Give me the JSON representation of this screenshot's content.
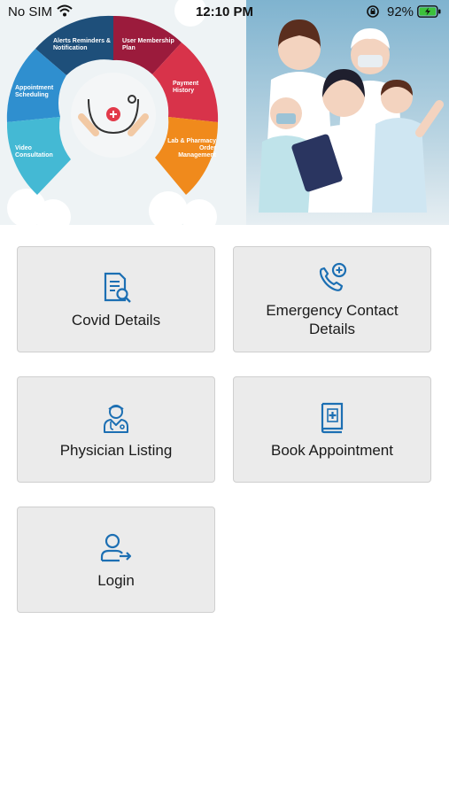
{
  "status_bar": {
    "carrier": "No SIM",
    "time": "12:10 PM",
    "battery_percent": "92%"
  },
  "banner": {
    "segments": [
      {
        "label": "Alerts Reminders & Notification",
        "color": "#1e4f7a"
      },
      {
        "label": "User Membership Plan",
        "color": "#9b1b3c"
      },
      {
        "label": "Payment History",
        "color": "#d8334a"
      },
      {
        "label": "Lab & Pharmacy Order Management",
        "color": "#f08a1c"
      },
      {
        "label": "Appointment Scheduling",
        "color": "#2f8fcf"
      },
      {
        "label": "Video Consultation",
        "color": "#44b9d4"
      }
    ]
  },
  "menu": {
    "covid_details": "Covid Details",
    "emergency_contact": "Emergency Contact Details",
    "physician_listing": "Physician Listing",
    "book_appointment": "Book Appointment",
    "login": "Login"
  },
  "icons": {
    "covid_details": "document-search-icon",
    "emergency_contact": "phone-plus-icon",
    "physician_listing": "doctor-icon",
    "book_appointment": "medical-book-icon",
    "login": "user-login-icon"
  },
  "colors": {
    "icon": "#1c6fb3",
    "tile_bg": "#ebebeb"
  }
}
